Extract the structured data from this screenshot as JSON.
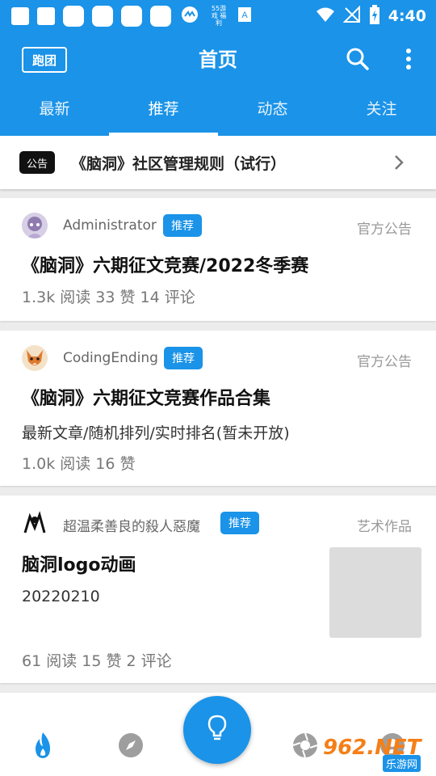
{
  "status_bar": {
    "time": "4:40",
    "mini_label": "55游戏 福利"
  },
  "app_bar": {
    "logo_text": "跑团",
    "title": "首页"
  },
  "tabs": [
    {
      "label": "最新"
    },
    {
      "label": "推荐"
    },
    {
      "label": "动态"
    },
    {
      "label": "关注"
    }
  ],
  "notice": {
    "badge": "公告",
    "text": "《脑洞》社区管理规则（试行）"
  },
  "posts": [
    {
      "author": "Administrator",
      "tag": "推荐",
      "category": "官方公告",
      "title": "《脑洞》六期征文竞赛/2022冬季赛",
      "stats": "1.3k 阅读 33 赞 14 评论"
    },
    {
      "author": "CodingEnding",
      "tag": "推荐",
      "category": "官方公告",
      "title": "《脑洞》六期征文竞赛作品合集",
      "description": "最新文章/随机排列/实时排名(暂未开放)",
      "stats": "1.0k 阅读 16 赞"
    },
    {
      "author": "超温柔善良的殺人惡魔",
      "tag": "推荐",
      "category": "艺术作品",
      "title": "脑洞logo动画",
      "description": "20220210",
      "stats": "61 阅读 15 赞 2 评论"
    }
  ],
  "watermark": {
    "brand": "962.NET",
    "sub": "乐游网"
  },
  "colors": {
    "primary": "#1a93e8",
    "badge_black": "#111111"
  }
}
